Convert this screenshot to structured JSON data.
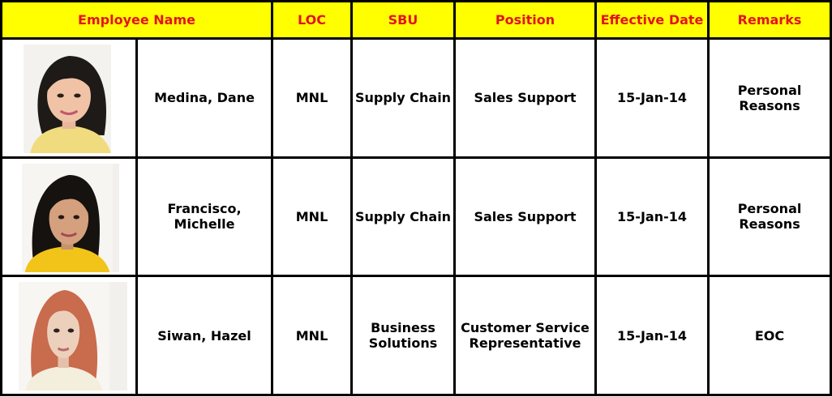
{
  "headers": {
    "employee_name": "Employee Name",
    "loc": "LOC",
    "sbu": "SBU",
    "position": "Position",
    "effective_date": "Effective Date",
    "remarks": "Remarks"
  },
  "rows": [
    {
      "name": "Medina, Dane",
      "loc": "MNL",
      "sbu": "Supply Chain",
      "position": "Sales Support",
      "effective_date": "15-Jan-14",
      "remarks": "Personal Reasons",
      "photo": "employee-photo"
    },
    {
      "name": "Francisco, Michelle",
      "loc": "MNL",
      "sbu": "Supply Chain",
      "position": "Sales Support",
      "effective_date": "15-Jan-14",
      "remarks": "Personal Reasons",
      "photo": "employee-photo"
    },
    {
      "name": "Siwan, Hazel",
      "loc": "MNL",
      "sbu": "Business Solutions",
      "position": "Customer Service Representative",
      "effective_date": "15-Jan-14",
      "remarks": "EOC",
      "photo": "employee-photo"
    }
  ],
  "colors": {
    "header_bg": "#ffff00",
    "header_text": "#e3141b",
    "border": "#000000"
  }
}
